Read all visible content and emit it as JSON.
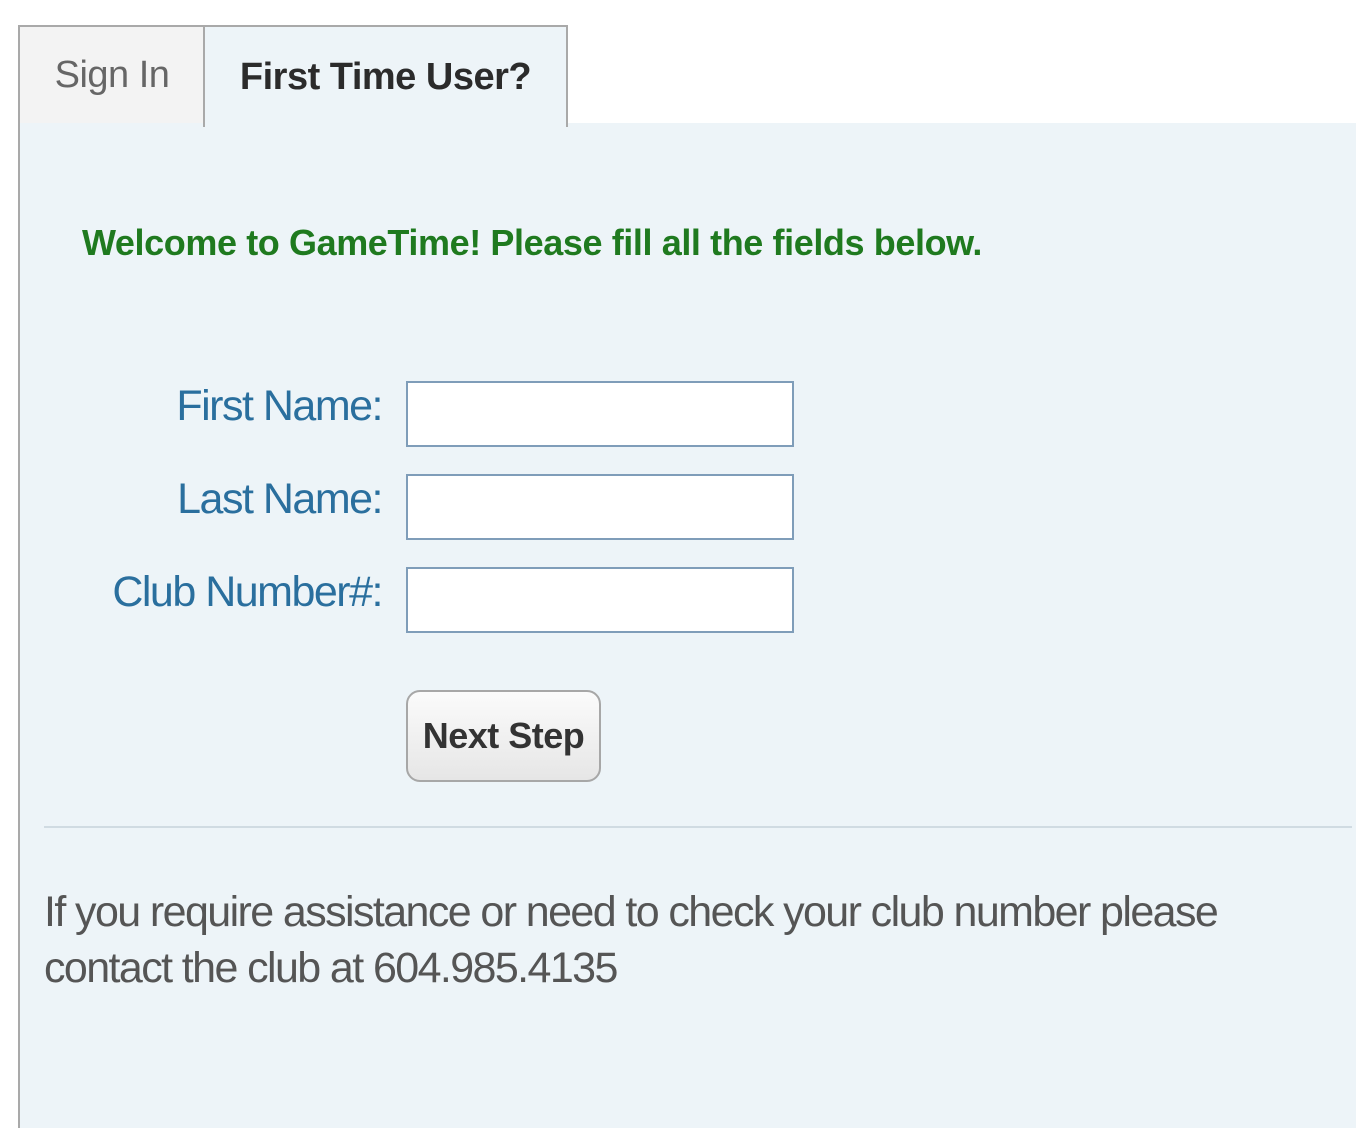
{
  "tabs": {
    "sign_in": "Sign In",
    "first_time_user": "First Time User?"
  },
  "welcome_message": "Welcome to GameTime! Please fill all the fields below.",
  "form": {
    "first_name_label": "First Name:",
    "first_name_value": "",
    "last_name_label": "Last Name:",
    "last_name_value": "",
    "club_number_label": "Club Number#:",
    "club_number_value": "",
    "next_button_label": "Next Step"
  },
  "assistance_text": "If you require assistance or need to check your club number please contact the club at 604.985.4135",
  "colors": {
    "welcome_green": "#1f7a1f",
    "label_blue": "#2a6f9e",
    "panel_background": "#edf4f8"
  }
}
